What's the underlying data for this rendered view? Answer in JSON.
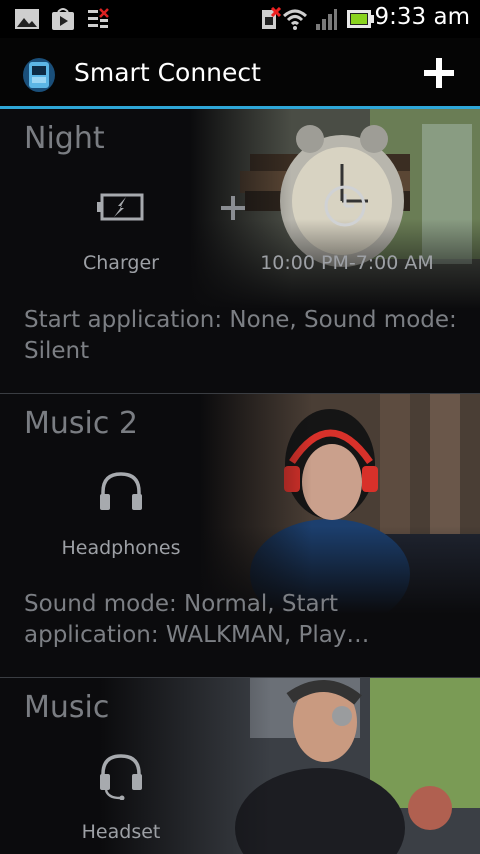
{
  "status_bar": {
    "time": "9:33 am",
    "icons": [
      "gallery-icon",
      "play-store-icon",
      "task-icon",
      "no-sim-icon",
      "wifi-icon",
      "signal-icon",
      "battery-icon"
    ]
  },
  "action_bar": {
    "title": "Smart Connect",
    "add_icon": "plus-icon",
    "accent_color": "#2fa7d8"
  },
  "events": [
    {
      "title": "Night",
      "conditions": [
        {
          "icon": "charger-icon",
          "label": "Charger"
        },
        {
          "icon": "clock-icon",
          "label": "10:00 PM-7:00 AM"
        }
      ],
      "description": "Start application: None, Sound mode: Silent"
    },
    {
      "title": "Music 2",
      "conditions": [
        {
          "icon": "headphones-icon",
          "label": "Headphones"
        }
      ],
      "description": "Sound mode: Normal, Start application: WALKMAN, Play…"
    },
    {
      "title": "Music",
      "conditions": [
        {
          "icon": "headset-icon",
          "label": "Headset"
        }
      ],
      "description": ""
    }
  ]
}
